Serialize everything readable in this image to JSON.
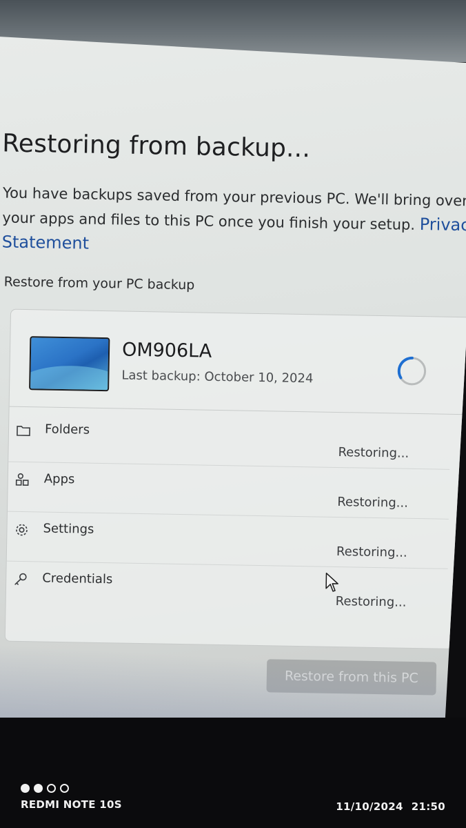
{
  "page": {
    "title": "Restoring from backup...",
    "description": "You have backups saved from your previous PC. We'll bring over your apps and files to this PC once you finish your setup.",
    "privacy_link": "Privacy Statement",
    "section_label": "Restore from your PC backup"
  },
  "device": {
    "name": "OM906LA",
    "last_backup": "Last backup: October 10, 2024",
    "thumbnail_icon": "desktop-thumbnail",
    "status_icon": "loading-spinner-icon"
  },
  "items": [
    {
      "icon": "folder-icon",
      "label": "Folders",
      "status": "Restoring..."
    },
    {
      "icon": "apps-icon",
      "label": "Apps",
      "status": "Restoring..."
    },
    {
      "icon": "gear-icon",
      "label": "Settings",
      "status": "Restoring..."
    },
    {
      "icon": "key-icon",
      "label": "Credentials",
      "status": "Restoring..."
    }
  ],
  "actions": {
    "restore_button": "Restore from this PC",
    "restore_enabled": false
  },
  "camera_watermark": {
    "model": "REDMI NOTE 10S",
    "date": "11/10/2024",
    "time": "21:50",
    "dots_filled": 2,
    "dots_total": 4
  },
  "colors": {
    "accent_link": "#1f4f9c",
    "spinner": "#1f6fd1",
    "button_disabled_bg": "#a8abab"
  }
}
